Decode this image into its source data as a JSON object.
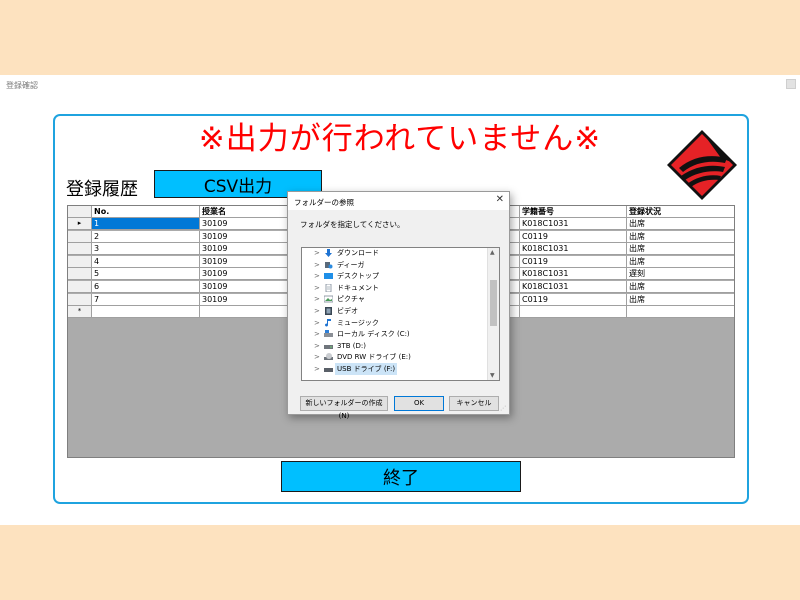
{
  "window": {
    "title": "登録確認"
  },
  "main": {
    "warning": "※出力が行われていません※",
    "history_label": "登録履歴",
    "csv_button": "CSV出力",
    "end_button": "終了"
  },
  "table": {
    "columns": [
      "No.",
      "授業名",
      "学籍番号",
      "登録状況"
    ],
    "rows": [
      {
        "no": "1",
        "course": "30109",
        "student": "K018C1031",
        "status": "出席"
      },
      {
        "no": "2",
        "course": "30109",
        "student": "C0119",
        "status": "出席"
      },
      {
        "no": "3",
        "course": "30109",
        "student": "K018C1031",
        "status": "出席"
      },
      {
        "no": "4",
        "course": "30109",
        "student": "C0119",
        "status": "出席"
      },
      {
        "no": "5",
        "course": "30109",
        "student": "K018C1031",
        "status": "遅刻"
      },
      {
        "no": "6",
        "course": "30109",
        "student": "K018C1031",
        "status": "出席"
      },
      {
        "no": "7",
        "course": "30109",
        "student": "C0119",
        "status": "出席"
      }
    ],
    "current_marker": "▸",
    "new_row_marker": "*"
  },
  "dialog": {
    "title": "フォルダーの参照",
    "instruction": "フォルダを指定してください。",
    "tree": [
      {
        "label": "ダウンロード",
        "icon": "download-icon"
      },
      {
        "label": "ディーガ",
        "icon": "media-server-icon"
      },
      {
        "label": "デスクトップ",
        "icon": "desktop-icon"
      },
      {
        "label": "ドキュメント",
        "icon": "document-icon"
      },
      {
        "label": "ピクチャ",
        "icon": "picture-icon"
      },
      {
        "label": "ビデオ",
        "icon": "video-icon"
      },
      {
        "label": "ミュージック",
        "icon": "music-icon"
      },
      {
        "label": "ローカル ディスク (C:)",
        "icon": "disk-icon"
      },
      {
        "label": "3TB (D:)",
        "icon": "drive-icon"
      },
      {
        "label": "DVD RW ドライブ (E:)",
        "icon": "dvd-drive-icon"
      },
      {
        "label": "USB ドライブ (F:)",
        "icon": "usb-drive-icon",
        "selected": true
      }
    ],
    "buttons": {
      "new_folder": "新しいフォルダーの作成(N)",
      "ok": "OK",
      "cancel": "キャンセル"
    }
  },
  "colors": {
    "warning": "#ff0000",
    "button": "#00bfff",
    "panel_border": "#1fa3df",
    "selection": "#0078d7",
    "background": "#fde2bf"
  }
}
